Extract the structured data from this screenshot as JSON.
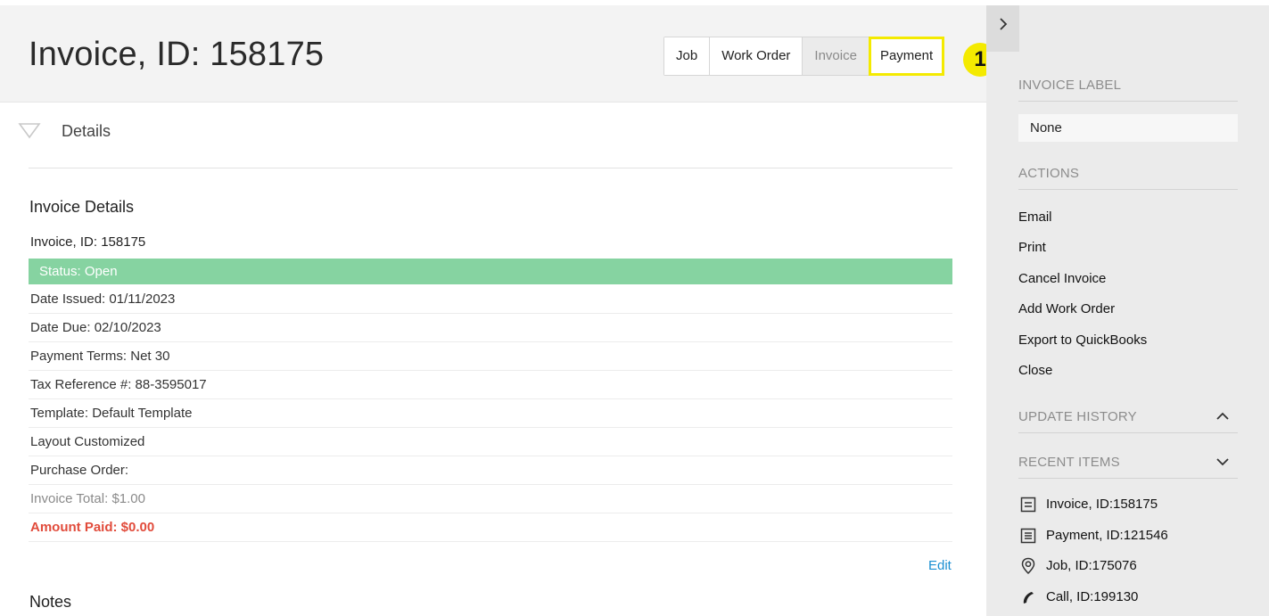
{
  "header": {
    "title": "Invoice, ID: 158175",
    "tabs": [
      {
        "label": "Job"
      },
      {
        "label": "Work Order"
      },
      {
        "label": "Invoice"
      },
      {
        "label": "Payment"
      }
    ],
    "callout": "1",
    "active_tab": "Invoice",
    "highlighted_tab": "Payment",
    "highlight_color": "#f4ea00"
  },
  "details": {
    "toggle_label": "Details",
    "section_title": "Invoice Details",
    "invoice_id": "Invoice, ID: 158175",
    "status": "Status: Open",
    "status_color": "#86d3a1",
    "rows": [
      "Date Issued: 01/11/2023",
      "Date Due: 02/10/2023",
      "Payment Terms: Net 30",
      "Tax Reference #: 88-3595017",
      "Template: Default Template",
      "Layout Customized",
      "Purchase Order:"
    ],
    "invoice_total": "Invoice Total: $1.00",
    "amount_paid": "Amount Paid: $0.00",
    "amount_paid_color": "#e14b3b",
    "edit_label": "Edit",
    "notes_title": "Notes"
  },
  "sidebar": {
    "invoice_label_heading": "INVOICE LABEL",
    "invoice_label_value": "None",
    "actions_heading": "ACTIONS",
    "actions": [
      "Email",
      "Print",
      "Cancel Invoice",
      "Add Work Order",
      "Export to QuickBooks",
      "Close"
    ],
    "update_history_heading": "UPDATE HISTORY",
    "recent_items_heading": "RECENT ITEMS",
    "recent_items": [
      {
        "label": "Invoice, ID:158175",
        "icon": "invoice-doc-icon"
      },
      {
        "label": "Payment, ID:121546",
        "icon": "payment-doc-icon"
      },
      {
        "label": "Job, ID:175076",
        "icon": "location-pin-icon"
      },
      {
        "label": "Call, ID:199130",
        "icon": "phone-icon"
      }
    ]
  }
}
